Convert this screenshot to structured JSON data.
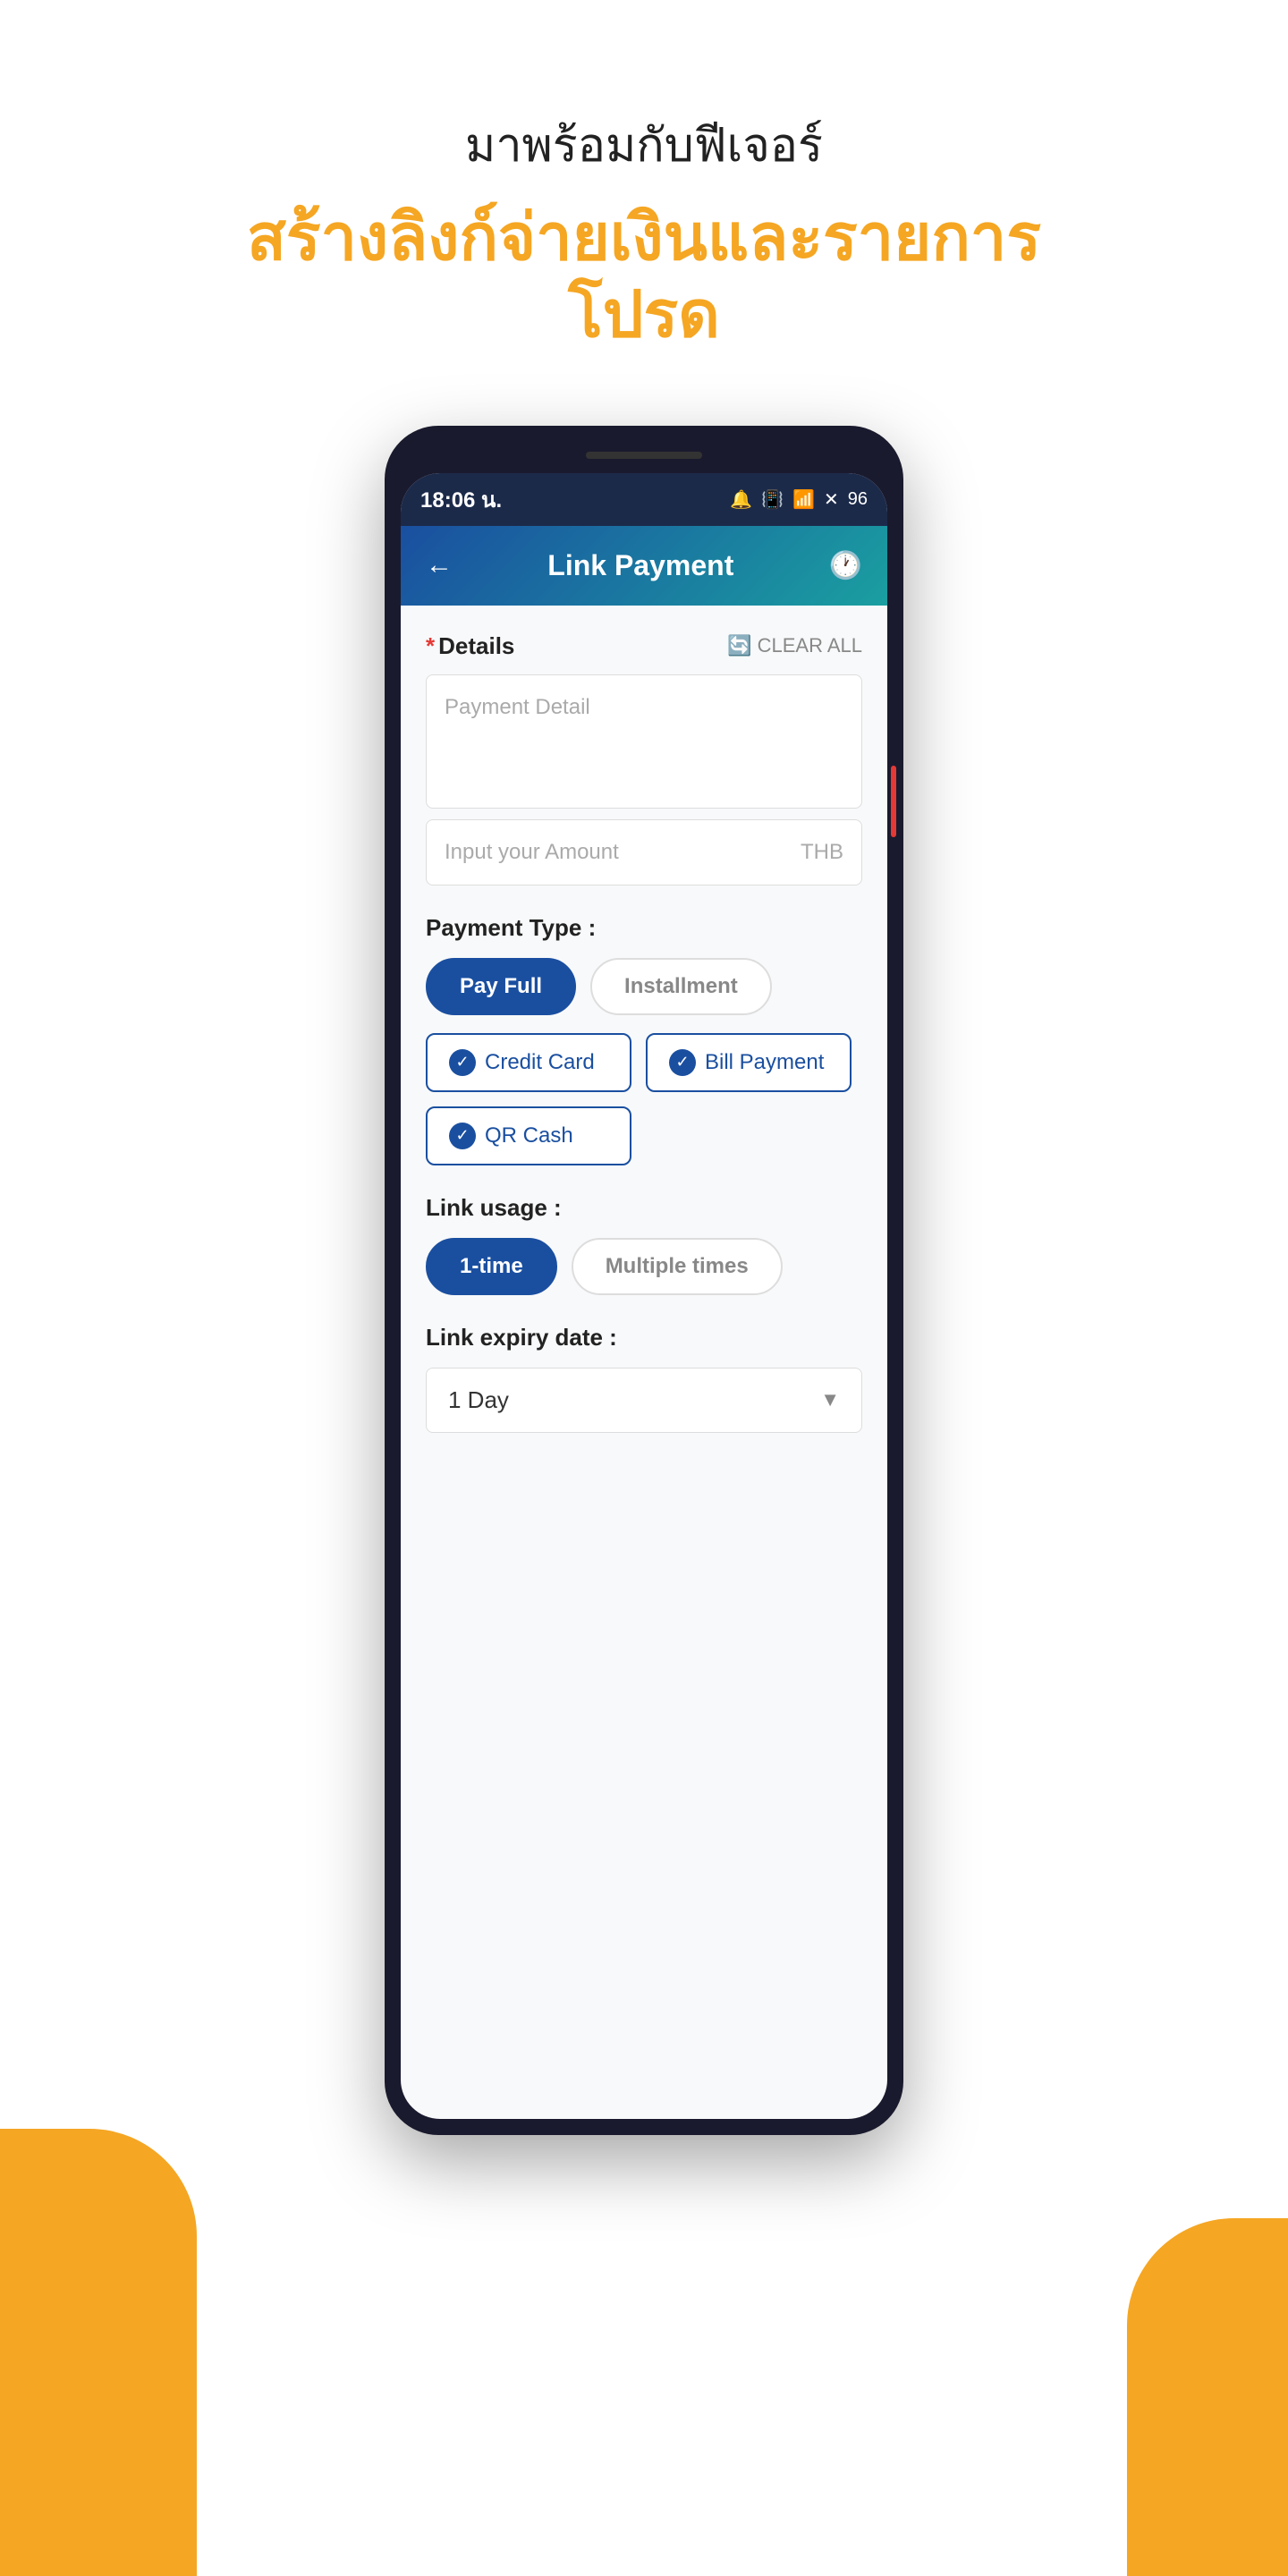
{
  "header": {
    "subtitle": "มาพร้อมกับฟีเจอร์",
    "title": "สร้างลิงก์จ่ายเงินและรายการโปรด"
  },
  "statusBar": {
    "time": "18:06 น.",
    "icons": "🔔 📷 ▶ 📳 📶 ✕📶 96"
  },
  "appHeader": {
    "backIcon": "←",
    "title": "Link Payment",
    "historyIcon": "🕐"
  },
  "form": {
    "detailsLabel": "Details",
    "clearAllLabel": "CLEAR ALL",
    "paymentDetailPlaceholder": "Payment Detail",
    "amountPlaceholder": "Input your Amount",
    "currency": "THB",
    "paymentTypeLabel": "Payment Type :",
    "paymentTypeOptions": [
      {
        "label": "Pay Full",
        "active": true
      },
      {
        "label": "Installment",
        "active": false
      }
    ],
    "paymentMethods": [
      {
        "label": "Credit Card",
        "checked": true
      },
      {
        "label": "Bill Payment",
        "checked": true
      },
      {
        "label": "QR Cash",
        "checked": true
      }
    ],
    "linkUsageLabel": "Link usage :",
    "linkUsageOptions": [
      {
        "label": "1-time",
        "active": true
      },
      {
        "label": "Multiple times",
        "active": false
      }
    ],
    "linkExpiryLabel": "Link expiry date :",
    "linkExpiryValue": "1 Day"
  }
}
